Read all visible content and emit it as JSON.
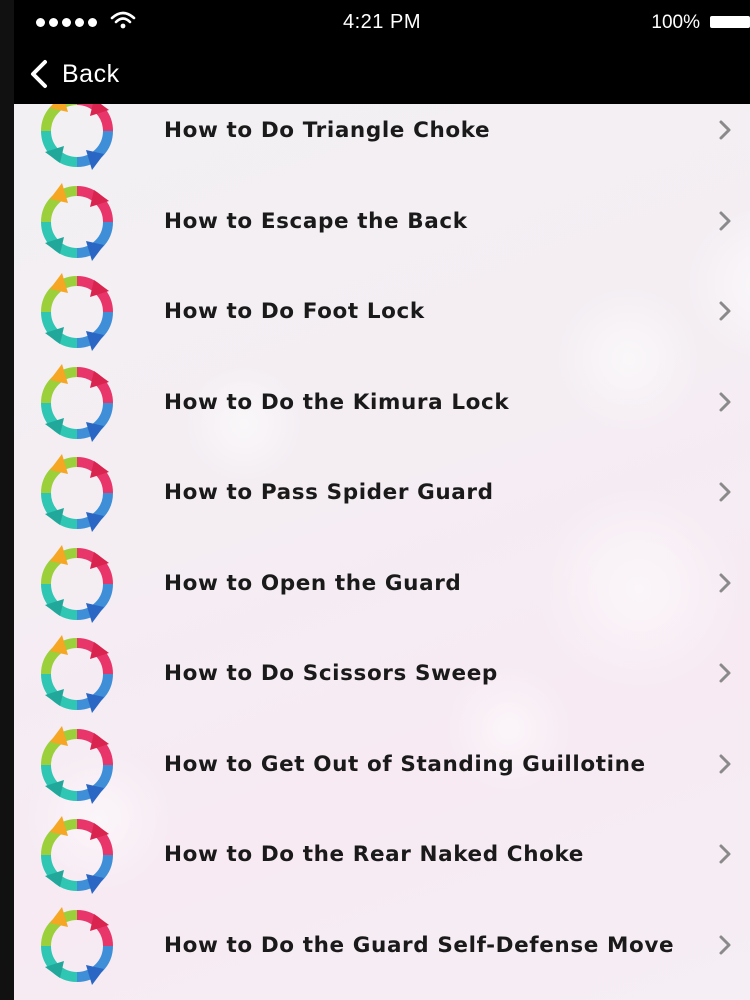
{
  "status_bar": {
    "time": "4:21 PM",
    "battery": "100%"
  },
  "nav": {
    "back_label": "Back"
  },
  "icons": {
    "list_item_icon": "refresh-cycle-icon",
    "chevron": "chevron-right-icon"
  },
  "colors": {
    "chevron": "#8a8a8a",
    "text": "#1a1a1a",
    "bar": "#000000"
  },
  "items": [
    {
      "label": "How to Do Triangle Choke"
    },
    {
      "label": "How to Escape the Back"
    },
    {
      "label": "How to Do Foot Lock"
    },
    {
      "label": "How to Do the Kimura Lock"
    },
    {
      "label": "How to Pass Spider Guard"
    },
    {
      "label": "How to Open the Guard"
    },
    {
      "label": "How to Do Scissors Sweep"
    },
    {
      "label": "How to Get Out of Standing Guillotine"
    },
    {
      "label": "How to Do the Rear Naked Choke"
    },
    {
      "label": "How to Do the Guard Self-Defense Move"
    }
  ]
}
